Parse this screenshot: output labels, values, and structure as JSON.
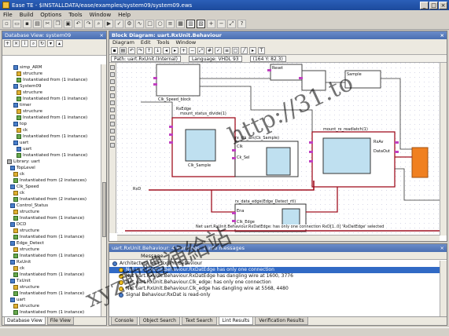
{
  "window": {
    "title": "Ease TE - $INSTALLDATA/ease/examples/system09/system09.ews",
    "controls": [
      "_",
      "□",
      "×"
    ]
  },
  "menubar": [
    "File",
    "Build",
    "Options",
    "Tools",
    "Window",
    "Help"
  ],
  "left_panel": {
    "title": "Database View: system09",
    "path": "",
    "tree": [
      "simp_ARM",
      "structure",
      "Instantiated from (1 instance)",
      "System09",
      "structure",
      "Instantiated from (1 instance)",
      "timer",
      "structure",
      "Instantiated from (1 instance)",
      "top",
      "ck",
      "Instantiated from (1 instance)",
      "uart",
      "uart",
      "Instantiated from (1 instance)",
      "Library: uart",
      "TopLevel",
      "ck",
      "Instantiated from (2 instances)",
      "Clk_Speed",
      "ck",
      "Instantiated from (2 instances)",
      "Control_Status",
      "structure",
      "Instantiated from (1 instance)",
      "DCD",
      "structure",
      "Instantiated from (1 instance)",
      "Edge_Detect",
      "structure",
      "Instantiated from (1 instance)",
      "RxUnit",
      "ck",
      "Instantiated from (1 instance)",
      "TxUnit",
      "structure",
      "Instantiated from (1 instance)",
      "uart",
      "structure",
      "Instantiated from (1 instance)"
    ],
    "tabs": [
      "Database View",
      "File View"
    ]
  },
  "diagram": {
    "title": "Block Diagram: uart.RxUnit.Behaviour",
    "menu": [
      "Diagram",
      "Edit",
      "Tools",
      "Window"
    ],
    "path_label": "Path: uart.RxUnit.(Internal)",
    "language": "Language: VHDL 93",
    "coords": "(164 Y: 82.3)",
    "blocks": [
      {
        "name": "Clk_Speed_block"
      },
      {
        "name": "mount_status_divide(1)"
      },
      {
        "name": "rx_clk_ain(Ck_Sample)"
      },
      {
        "name": "mount_rx_readlatch(1)"
      },
      {
        "name": "rx_data_edge(Edge_Detect_rtl)"
      }
    ],
    "labels": [
      "RxEdge",
      "Reset",
      "Clk",
      "Clk_Sample",
      "Ck_Sel",
      "RxD",
      "RxAv",
      "DataOut",
      "Ena",
      "Sample",
      "Clk_Edge"
    ],
    "status_text": "Net uart.RxUnit.Behaviour.RxDatEdge: has only one connection    RxD[1..0] 'RxDatEdge' selected"
  },
  "messages": {
    "header": "Message",
    "title": "uart.RxUnit.Behaviour: 4 warnings, 1 info messages",
    "rows": [
      {
        "text": "Architecture uart.RxUnit.Behaviour",
        "kind": "info",
        "root": true
      },
      {
        "text": "Net uart.RxUnit.Behaviour.RxDatEdge has only one connection",
        "kind": "warn",
        "selected": true
      },
      {
        "text": "Net uart.RxUnit.Behaviour.RxDatEdge has dangling wire at 1600, 3776",
        "kind": "warn"
      },
      {
        "text": "Net uart.RxUnit.Behaviour.Clk_edge: has only one connection",
        "kind": "warn"
      },
      {
        "text": "Net uart.RxUnit.Behaviour.Clk_edge has dangling wire at 5568, 4480",
        "kind": "warn"
      },
      {
        "text": "Signal Behaviour.RxDat is read-only",
        "kind": "info"
      }
    ],
    "tabs": [
      "Console",
      "Object Search",
      "Text Search",
      "Lint Results",
      "Verification Results"
    ]
  },
  "watermark": {
    "line1": "http://31.to",
    "line2": "xyz軟體補給站"
  },
  "colors": {
    "titlebar": "#2b5fb8",
    "selection": "#316ac5",
    "wire_red": "#a01020",
    "block_fill": "#bfe0f0",
    "port_magenta": "#c040c0",
    "orange_block": "#f08020"
  }
}
